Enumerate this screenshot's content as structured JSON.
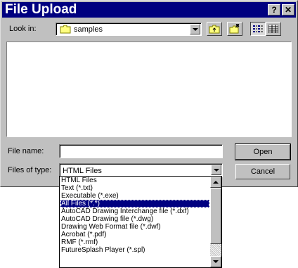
{
  "window": {
    "title": "File Upload",
    "help_button": "?",
    "close_button": "✕"
  },
  "lookin": {
    "label": "Look in:",
    "value": "samples"
  },
  "filename": {
    "label": "File name:",
    "value": ""
  },
  "filetype": {
    "label": "Files of type:",
    "value": "HTML Files"
  },
  "buttons": {
    "open": "Open",
    "cancel": "Cancel"
  },
  "filetype_options": [
    "HTML Files",
    "Text (*.txt)",
    "Executable (*.exe)",
    "All Files (*.*)",
    "AutoCAD Drawing Interchange file (*.dxf)",
    "AutoCAD Drawing file (*.dwg)",
    "Drawing Web Format file (*.dwf)",
    "Acrobat (*.pdf)",
    "RMF (*.rmf)",
    "FutureSplash Player (*.spl)"
  ],
  "selected_option": "All Files (*.*)",
  "colors": {
    "titlebar": "#000080",
    "face": "#c0c0c0",
    "selection": "#000080"
  }
}
